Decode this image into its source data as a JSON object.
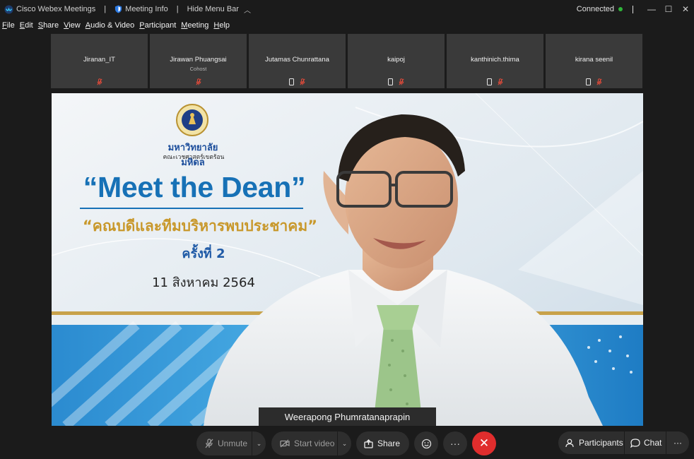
{
  "titlebar": {
    "app_name": "Cisco Webex Meetings",
    "meeting_info": "Meeting Info",
    "hide_menu_bar": "Hide Menu Bar",
    "status": "Connected"
  },
  "menu": [
    {
      "key": "F",
      "rest": "ile"
    },
    {
      "key": "E",
      "rest": "dit"
    },
    {
      "key": "S",
      "rest": "hare"
    },
    {
      "key": "V",
      "rest": "iew"
    },
    {
      "key": "A",
      "rest": "udio & Video"
    },
    {
      "key": "P",
      "rest": "articipant"
    },
    {
      "key": "M",
      "rest": "eeting"
    },
    {
      "key": "H",
      "rest": "elp"
    }
  ],
  "participants": [
    {
      "name": "Jiranan_IT",
      "role": "",
      "phone": false
    },
    {
      "name": "Jirawan Phuangsai",
      "role": "Cohost",
      "phone": false
    },
    {
      "name": "Jutamas Chunrattana",
      "role": "",
      "phone": true
    },
    {
      "name": "kaipoj",
      "role": "",
      "phone": true
    },
    {
      "name": "kanthinich.thima",
      "role": "",
      "phone": true
    },
    {
      "name": "kirana seenil",
      "role": "",
      "phone": true
    }
  ],
  "slide": {
    "university": "มหาวิทยาลัยมหิดล",
    "faculty": "คณะเวชศาสตร์เขตร้อน",
    "headline": "“Meet the Dean”",
    "subtitle": "“คณบดีและทีมบริหารพบประชาคม”",
    "session": "ครั้งที่ 2",
    "date": "11 สิงหาคม 2564"
  },
  "active_speaker": "Weerapong Phumratanaprapin",
  "controls": {
    "unmute": "Unmute",
    "start_video": "Start video",
    "share": "Share",
    "more": "···",
    "end": "✕",
    "participants": "Participants",
    "chat": "Chat"
  },
  "colors": {
    "mute_red": "#e04a3a",
    "end_red": "#e02d2d",
    "connected_green": "#2fb53a",
    "headline_blue": "#1771b6",
    "subtitle_gold": "#c8982b"
  }
}
